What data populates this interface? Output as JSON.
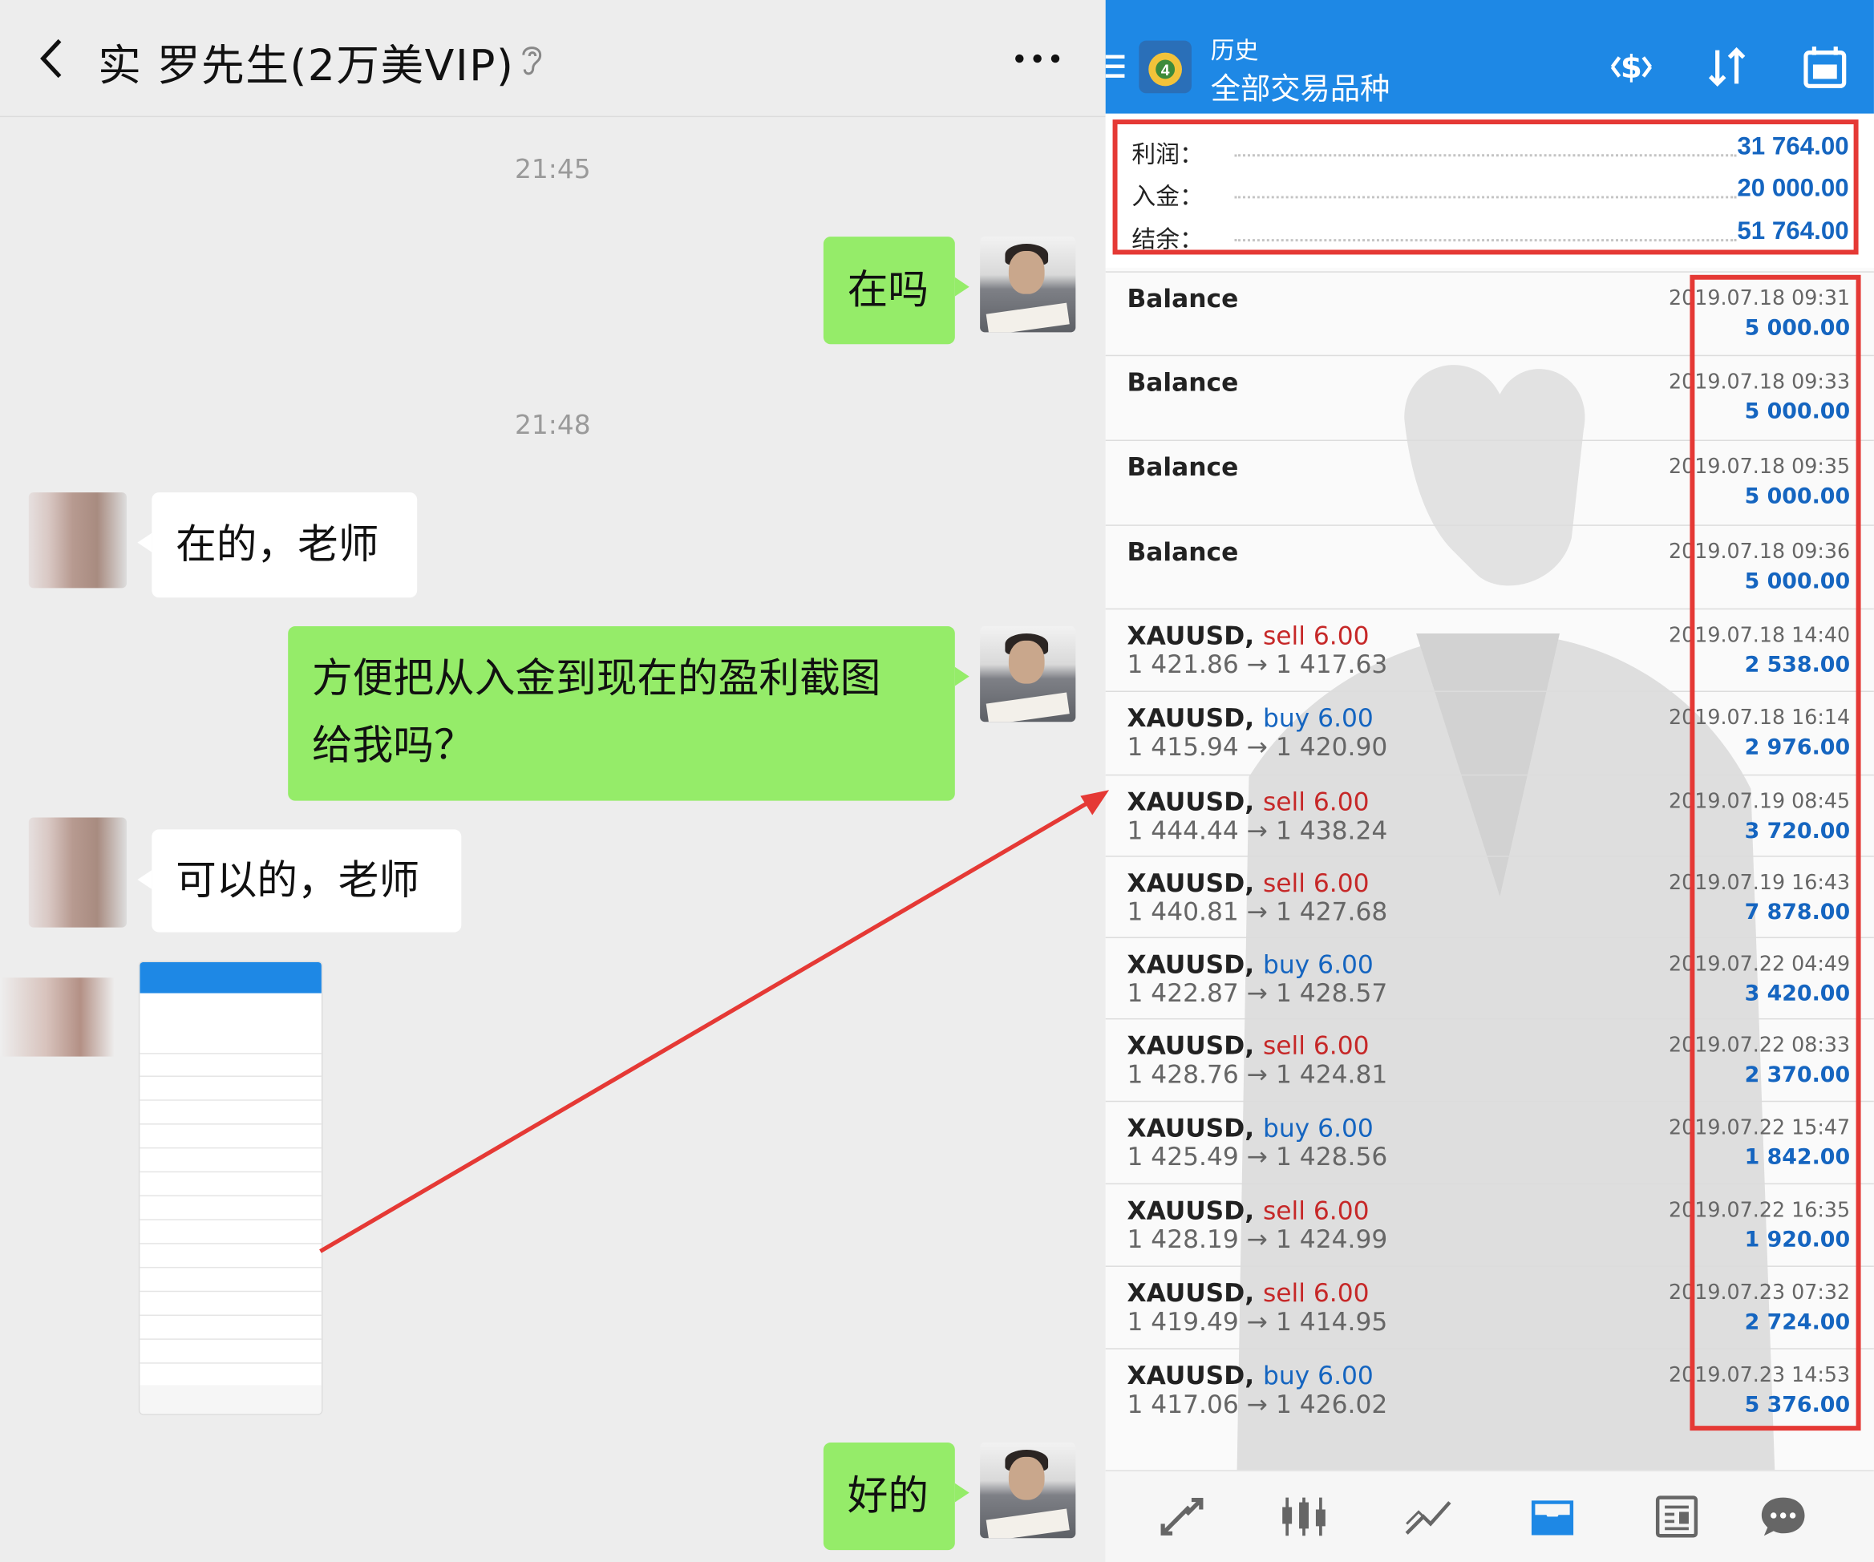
{
  "chat": {
    "title": "实  罗先生(2万美VIP)",
    "timestamps": [
      "21:45",
      "21:48"
    ],
    "messages": [
      {
        "from": "me",
        "text": "在吗"
      },
      {
        "from": "peer",
        "text": "在的，老师"
      },
      {
        "from": "me",
        "line1": "方便把从入金到现在的盈利截图",
        "line2": "给我吗？"
      },
      {
        "from": "peer",
        "text": "可以的，老师"
      },
      {
        "from": "peer",
        "type": "image"
      },
      {
        "from": "me",
        "text": "好的"
      }
    ]
  },
  "mt4": {
    "appbar": {
      "title": "历史",
      "subtitle": "全部交易品种"
    },
    "summary": {
      "profit_label": "利润：",
      "profit_value": "31 764.00",
      "deposit_label": "入金：",
      "deposit_value": "20 000.00",
      "balance_label": "结余：",
      "balance_value": "51 764.00"
    },
    "rows": [
      {
        "symbol": "Balance",
        "side": "",
        "side_type": "",
        "lots": "",
        "prices": "",
        "date": "2019.07.18 09:31",
        "profit": "5 000.00"
      },
      {
        "symbol": "Balance",
        "side": "",
        "side_type": "",
        "lots": "",
        "prices": "",
        "date": "2019.07.18 09:33",
        "profit": "5 000.00"
      },
      {
        "symbol": "Balance",
        "side": "",
        "side_type": "",
        "lots": "",
        "prices": "",
        "date": "2019.07.18 09:35",
        "profit": "5 000.00"
      },
      {
        "symbol": "Balance",
        "side": "",
        "side_type": "",
        "lots": "",
        "prices": "",
        "date": "2019.07.18 09:36",
        "profit": "5 000.00"
      },
      {
        "symbol": "XAUUSD,",
        "side": "sell 6.00",
        "side_type": "sell",
        "prices": "1 421.86 → 1 417.63",
        "date": "2019.07.18 14:40",
        "profit": "2 538.00"
      },
      {
        "symbol": "XAUUSD,",
        "side": "buy 6.00",
        "side_type": "buy",
        "prices": "1 415.94 → 1 420.90",
        "date": "2019.07.18 16:14",
        "profit": "2 976.00"
      },
      {
        "symbol": "XAUUSD,",
        "side": "sell 6.00",
        "side_type": "sell",
        "prices": "1 444.44 → 1 438.24",
        "date": "2019.07.19 08:45",
        "profit": "3 720.00"
      },
      {
        "symbol": "XAUUSD,",
        "side": "sell 6.00",
        "side_type": "sell",
        "prices": "1 440.81 → 1 427.68",
        "date": "2019.07.19 16:43",
        "profit": "7 878.00"
      },
      {
        "symbol": "XAUUSD,",
        "side": "buy 6.00",
        "side_type": "buy",
        "prices": "1 422.87 → 1 428.57",
        "date": "2019.07.22 04:49",
        "profit": "3 420.00"
      },
      {
        "symbol": "XAUUSD,",
        "side": "sell 6.00",
        "side_type": "sell",
        "prices": "1 428.76 → 1 424.81",
        "date": "2019.07.22 08:33",
        "profit": "2 370.00"
      },
      {
        "symbol": "XAUUSD,",
        "side": "buy 6.00",
        "side_type": "buy",
        "prices": "1 425.49 → 1 428.56",
        "date": "2019.07.22 15:47",
        "profit": "1 842.00"
      },
      {
        "symbol": "XAUUSD,",
        "side": "sell 6.00",
        "side_type": "sell",
        "prices": "1 428.19 → 1 424.99",
        "date": "2019.07.22 16:35",
        "profit": "1 920.00"
      },
      {
        "symbol": "XAUUSD,",
        "side": "sell 6.00",
        "side_type": "sell",
        "prices": "1 419.49 → 1 414.95",
        "date": "2019.07.23 07:32",
        "profit": "2 724.00"
      },
      {
        "symbol": "XAUUSD,",
        "side": "buy 6.00",
        "side_type": "buy",
        "prices": "1 417.06 → 1 426.02",
        "date": "2019.07.23 14:53",
        "profit": "5 376.00"
      }
    ],
    "bottom_nav": [
      "trade-icon",
      "quotes-icon",
      "chart-icon",
      "history-icon",
      "news-icon",
      "chat-icon"
    ]
  },
  "colors": {
    "chat_bg": "#ededed",
    "my_bubble": "#95ec69",
    "peer_bubble": "#ffffff",
    "appbar": "#1e88e5",
    "sell": "#c62828",
    "buy": "#1565c0",
    "highlight": "#e53935"
  }
}
